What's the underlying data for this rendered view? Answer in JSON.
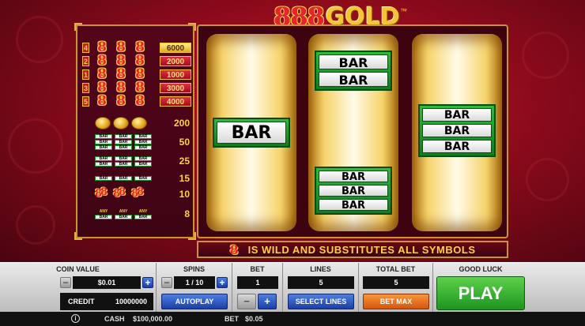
{
  "logo": {
    "num": "888",
    "word": "GOLD",
    "tm": "™"
  },
  "paytable": {
    "lines": [
      {
        "num": "4",
        "pay": "6000",
        "style": "gold"
      },
      {
        "num": "2",
        "pay": "2000",
        "style": "red"
      },
      {
        "num": "1",
        "pay": "1000",
        "style": "red"
      },
      {
        "num": "3",
        "pay": "3000",
        "style": "red"
      },
      {
        "num": "5",
        "pay": "4000",
        "style": "red"
      }
    ],
    "seven_char": "8",
    "rows": [
      {
        "symbol": "coin",
        "value": "200"
      },
      {
        "symbol": "triple-bar",
        "value": "50"
      },
      {
        "symbol": "double-bar",
        "value": "25"
      },
      {
        "symbol": "single-bar",
        "value": "15"
      },
      {
        "symbol": "red-seven",
        "value": "10"
      },
      {
        "symbol": "any-bar",
        "value": "8",
        "any_label": "ANY"
      }
    ],
    "mini_bar_label": "BAR"
  },
  "reels": {
    "bar_label": "BAR"
  },
  "banner": {
    "eight": "8",
    "text": "IS WILD AND SUBSTITUTES ALL SYMBOLS"
  },
  "controls": {
    "coin_value": {
      "title": "COIN VALUE",
      "value": "$0.01",
      "minus": "−",
      "plus": "+"
    },
    "credit": {
      "label": "CREDIT",
      "value": "10000000"
    },
    "spins": {
      "title": "SPINS",
      "value": "1 / 10",
      "minus": "−",
      "plus": "+",
      "autoplay": "AUTOPLAY"
    },
    "bet": {
      "title": "BET",
      "value": "1",
      "minus": "−",
      "plus": "+"
    },
    "lines": {
      "title": "LINES",
      "value": "5",
      "select": "SELECT LINES"
    },
    "total_bet": {
      "title": "TOTAL BET",
      "value": "5",
      "betmax": "BET MAX"
    },
    "good_luck": {
      "title": "GOOD LUCK",
      "play": "PLAY"
    }
  },
  "status": {
    "info": "i",
    "cash_label": "CASH",
    "cash_value": "$100,000.00",
    "bet_label": "BET",
    "bet_value": "$0.05"
  },
  "colors": {
    "background_red": "#c01a2c",
    "gold": "#f6c433",
    "bar_green": "#2fbb3c",
    "play_green": "#1e9422",
    "button_blue": "#1a3fa6",
    "betmax_orange": "#d4560d"
  }
}
